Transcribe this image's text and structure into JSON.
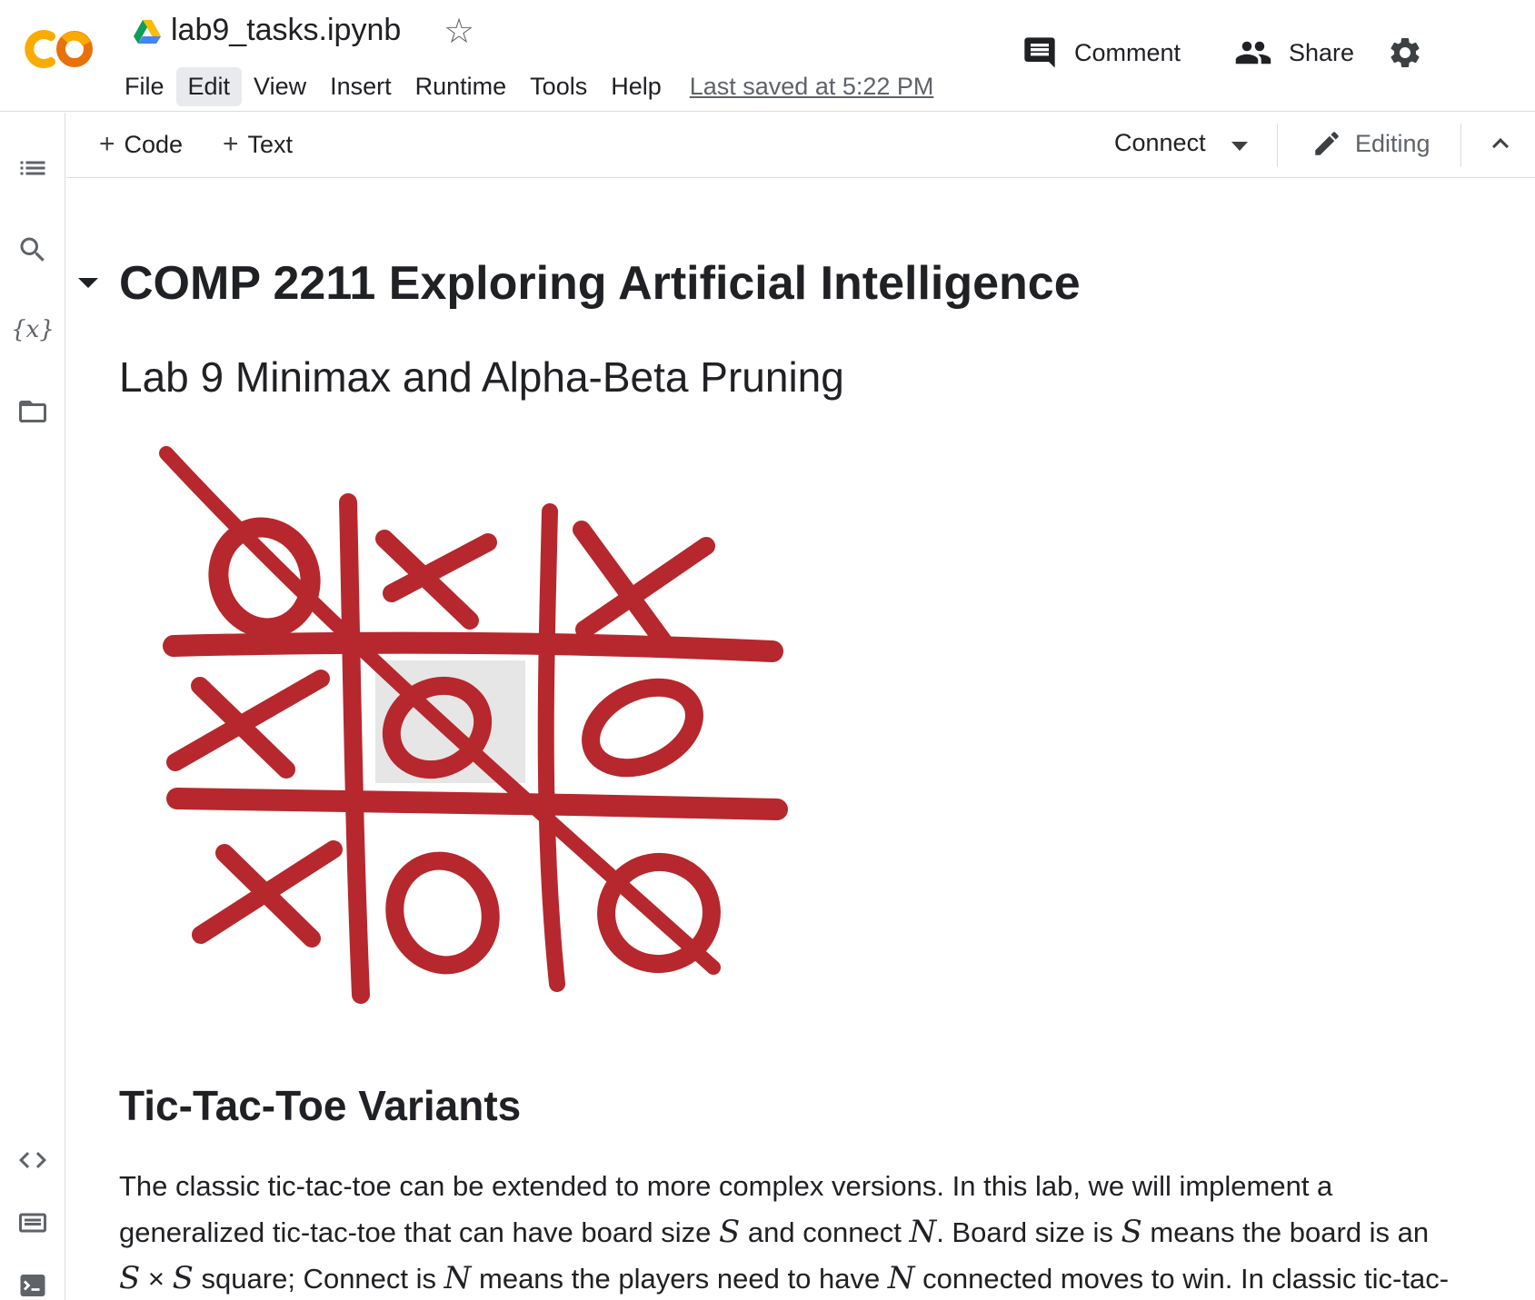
{
  "header": {
    "file_name": "lab9_tasks.ipynb",
    "menu": [
      "File",
      "Edit",
      "View",
      "Insert",
      "Runtime",
      "Tools",
      "Help"
    ],
    "active_menu": "Edit",
    "last_saved": "Last saved at 5:22 PM",
    "comment_label": "Comment",
    "share_label": "Share"
  },
  "toolbar": {
    "add_code": "Code",
    "add_text": "Text",
    "connect": "Connect",
    "editing": "Editing"
  },
  "rail": {
    "variables_label": "{x}"
  },
  "notebook": {
    "title": "COMP 2211 Exploring Artificial Intelligence",
    "subtitle": "Lab 9 Minimax and Alpha-Beta Pruning",
    "section_heading": "Tic-Tac-Toe Variants",
    "paragraph": {
      "l1": "The classic tic-tac-toe can be extended to more complex versions. In this lab, we will implement a",
      "l2_a": "generalized tic-tac-toe that can have board size ",
      "l2_m1": "S",
      "l2_b": " and connect ",
      "l2_m2": "N",
      "l2_c": ". Board size is ",
      "l2_m3": "S",
      "l2_d": " means the board is an",
      "l3_m1": "S",
      "l3_x": " × ",
      "l3_m2": "S",
      "l3_a": " square; Connect is ",
      "l3_m3": "N",
      "l3_b": " means the players need to have ",
      "l3_m4": "N",
      "l3_c": " connected moves to win. In classic tic-tac-"
    }
  },
  "colors": {
    "brand_orange": "#f9ab00",
    "brand_orange_dark": "#e8710a",
    "ink_red": "#b0161c",
    "highlight_cell": "#e4e4e4",
    "text": "#202124",
    "secondary_text": "#5f6368"
  },
  "icons": {
    "logo": "colab-logo",
    "drive": "google-drive-icon",
    "star": "star-outline-icon",
    "comment": "comment-icon",
    "share": "people-icon",
    "settings": "gear-icon",
    "toc": "table-of-contents-icon",
    "search": "search-icon",
    "variables": "variables-icon",
    "files": "folder-icon",
    "code_snippets": "code-icon",
    "command_palette": "keyboard-icon",
    "terminal": "terminal-icon",
    "editing": "pencil-icon",
    "collapse": "chevron-up-icon",
    "cell_toggle": "triangle-down-icon"
  }
}
